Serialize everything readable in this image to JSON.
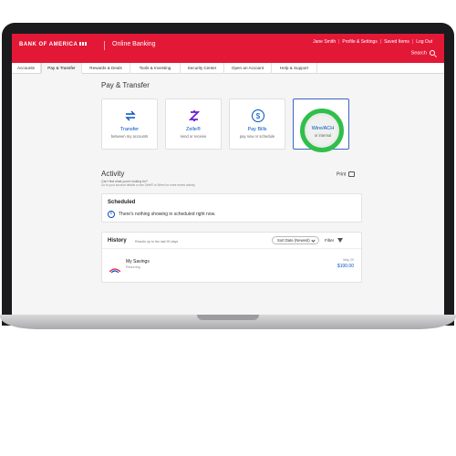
{
  "header": {
    "brand": "BANK OF AMERICA",
    "product": "Online Banking",
    "user_name": "Jane Smith",
    "links": [
      "Profile & Settings",
      "Saved Items",
      "Log Out"
    ],
    "search_label": "Search"
  },
  "nav": {
    "tabs": [
      {
        "label": "Accounts"
      },
      {
        "label": "Pay & Transfer"
      },
      {
        "label": "Rewards & Deals"
      },
      {
        "label": "Tools & Investing"
      },
      {
        "label": "Security Center"
      },
      {
        "label": "Open an Account"
      },
      {
        "label": "Help & Support"
      }
    ],
    "active_tab": "Pay & Transfer"
  },
  "main": {
    "title": "Pay & Transfer",
    "cards": [
      {
        "title": "Transfer",
        "subtitle": "between my accounts",
        "icon": "transfer-arrows-icon"
      },
      {
        "title": "Zelle®",
        "subtitle": "send or receive",
        "icon": "zelle-icon"
      },
      {
        "title": "Pay Bills",
        "subtitle": "pay now or schedule",
        "icon": "dollar-arrow-icon"
      },
      {
        "title": "Wire/ACH",
        "subtitle": "or internal",
        "icon": "wire-icon",
        "selected": true
      }
    ]
  },
  "activity": {
    "title": "Activity",
    "help_text": "Can't find what you're looking for?",
    "help_sub": "Go to your account details or see Zelle® or Wires for more recent activity",
    "print_label": "Print",
    "scheduled": {
      "title": "Scheduled",
      "message": "There's nothing showing in scheduled right now."
    },
    "history": {
      "title": "History",
      "note": "Results up to the last 90 days",
      "sort_value": "Sort Date (Newest)",
      "filter_label": "Filter",
      "rows": [
        {
          "account": "My Savings",
          "type": "Recurring",
          "date": "May 20",
          "amount": "$100.00"
        }
      ]
    }
  },
  "colors": {
    "brand_red": "#e31837",
    "link_blue": "#0052c2",
    "highlight_green": "#2fbf4a"
  }
}
